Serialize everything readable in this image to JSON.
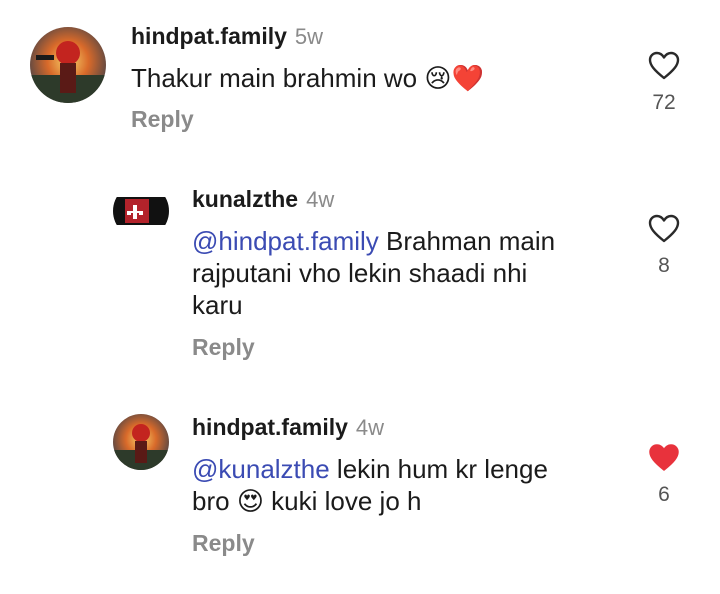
{
  "comments": [
    {
      "username": "hindpat.family",
      "time": "5w",
      "text": "Thakur main brahmin wo",
      "emoji": "😢❤️",
      "reply_label": "Reply",
      "like_count": "72",
      "liked": false,
      "avatar_icon": "avatar-trishul-icon"
    },
    {
      "username": "kunalzthe",
      "time": "4w",
      "mention": "@hindpat.family",
      "text_line1": " Brahman main",
      "text_line2": "rajputani vho lekin shaadi nhi",
      "text_line3": "karu",
      "reply_label": "Reply",
      "like_count": "8",
      "liked": false,
      "avatar_icon": "avatar-swastik-icon"
    },
    {
      "username": "hindpat.family",
      "time": "4w",
      "mention": "@kunalzthe",
      "text_line1": " lekin hum kr lenge",
      "text_line2_a": "bro",
      "text_line2_emoji": "😍",
      "text_line2_b": "kuki love jo h",
      "reply_label": "Reply",
      "like_count": "6",
      "liked": true,
      "avatar_icon": "avatar-trishul-icon"
    }
  ],
  "colors": {
    "mention": "#3b4bb3",
    "liked_heart": "#e8323c",
    "muted": "#8a8a8a"
  }
}
